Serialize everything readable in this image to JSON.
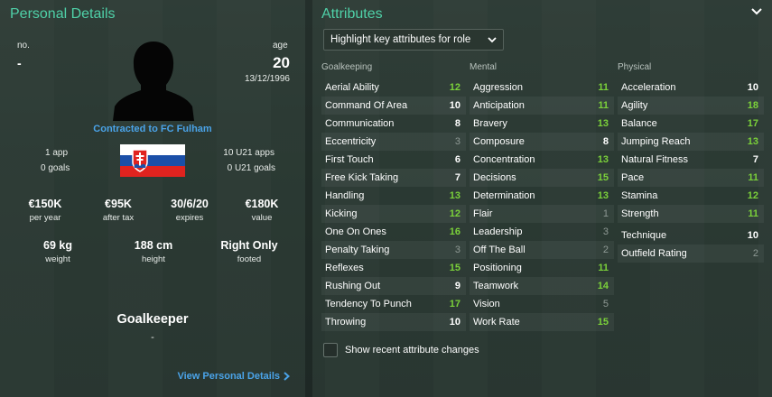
{
  "personal": {
    "title": "Personal Details",
    "no_label": "no.",
    "no_value": "-",
    "age_label": "age",
    "age_value": "20",
    "dob": "13/12/1996",
    "contract": "Contracted to FC Fulham",
    "apps": "1 app",
    "goals": "0 goals",
    "u21_apps": "10 U21 apps",
    "u21_goals": "0 U21 goals",
    "stats": [
      {
        "value": "€150K",
        "label": "per year"
      },
      {
        "value": "€95K",
        "label": "after tax"
      },
      {
        "value": "30/6/20",
        "label": "expires"
      },
      {
        "value": "€180K",
        "label": "value"
      }
    ],
    "physical": [
      {
        "value": "69 kg",
        "label": "weight"
      },
      {
        "value": "188 cm",
        "label": "height"
      },
      {
        "value": "Right Only",
        "label": "footed"
      }
    ],
    "position": "Goalkeeper",
    "position_sub": "-",
    "view_link": "View Personal Details"
  },
  "attributes": {
    "title": "Attributes",
    "role_select": "Highlight key attributes for role",
    "groups": [
      {
        "header": "Goalkeeping",
        "items": [
          {
            "name": "Aerial Ability",
            "value": "12",
            "tone": "green"
          },
          {
            "name": "Command Of Area",
            "value": "10",
            "tone": "white"
          },
          {
            "name": "Communication",
            "value": "8",
            "tone": "white"
          },
          {
            "name": "Eccentricity",
            "value": "3",
            "tone": "grey"
          },
          {
            "name": "First Touch",
            "value": "6",
            "tone": "white"
          },
          {
            "name": "Free Kick Taking",
            "value": "7",
            "tone": "white"
          },
          {
            "name": "Handling",
            "value": "13",
            "tone": "green"
          },
          {
            "name": "Kicking",
            "value": "12",
            "tone": "green"
          },
          {
            "name": "One On Ones",
            "value": "16",
            "tone": "green"
          },
          {
            "name": "Penalty Taking",
            "value": "3",
            "tone": "grey"
          },
          {
            "name": "Reflexes",
            "value": "15",
            "tone": "green"
          },
          {
            "name": "Rushing Out",
            "value": "9",
            "tone": "white"
          },
          {
            "name": "Tendency To Punch",
            "value": "17",
            "tone": "green"
          },
          {
            "name": "Throwing",
            "value": "10",
            "tone": "white"
          }
        ]
      },
      {
        "header": "Mental",
        "items": [
          {
            "name": "Aggression",
            "value": "11",
            "tone": "green"
          },
          {
            "name": "Anticipation",
            "value": "11",
            "tone": "green"
          },
          {
            "name": "Bravery",
            "value": "13",
            "tone": "green"
          },
          {
            "name": "Composure",
            "value": "8",
            "tone": "white"
          },
          {
            "name": "Concentration",
            "value": "13",
            "tone": "green"
          },
          {
            "name": "Decisions",
            "value": "15",
            "tone": "green"
          },
          {
            "name": "Determination",
            "value": "13",
            "tone": "green"
          },
          {
            "name": "Flair",
            "value": "1",
            "tone": "grey"
          },
          {
            "name": "Leadership",
            "value": "3",
            "tone": "grey"
          },
          {
            "name": "Off The Ball",
            "value": "2",
            "tone": "grey"
          },
          {
            "name": "Positioning",
            "value": "11",
            "tone": "green"
          },
          {
            "name": "Teamwork",
            "value": "14",
            "tone": "green"
          },
          {
            "name": "Vision",
            "value": "5",
            "tone": "grey"
          },
          {
            "name": "Work Rate",
            "value": "15",
            "tone": "green"
          }
        ]
      },
      {
        "header": "Physical",
        "items": [
          {
            "name": "Acceleration",
            "value": "10",
            "tone": "white"
          },
          {
            "name": "Agility",
            "value": "18",
            "tone": "green"
          },
          {
            "name": "Balance",
            "value": "17",
            "tone": "green"
          },
          {
            "name": "Jumping Reach",
            "value": "13",
            "tone": "green"
          },
          {
            "name": "Natural Fitness",
            "value": "7",
            "tone": "white"
          },
          {
            "name": "Pace",
            "value": "11",
            "tone": "green"
          },
          {
            "name": "Stamina",
            "value": "12",
            "tone": "green"
          },
          {
            "name": "Strength",
            "value": "11",
            "tone": "green"
          }
        ]
      }
    ],
    "extra": [
      {
        "name": "Technique",
        "value": "10",
        "tone": "white"
      },
      {
        "name": "Outfield Rating",
        "value": "2",
        "tone": "grey"
      }
    ],
    "checkbox_label": "Show recent attribute changes"
  },
  "colors": {
    "accent_title": "#4fd1a8",
    "link": "#4aa3e8",
    "attr_high": "#7bd13a",
    "attr_low": "#8e9994"
  }
}
